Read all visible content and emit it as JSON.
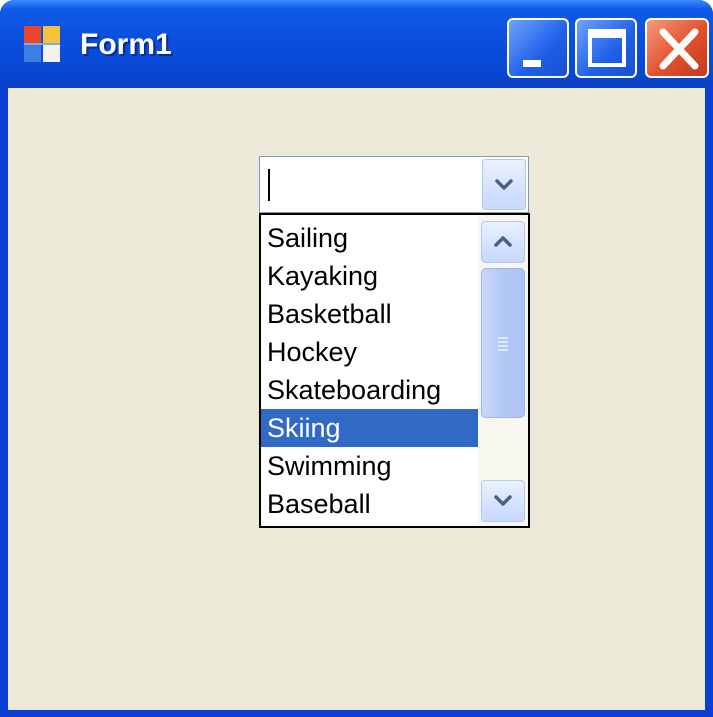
{
  "window": {
    "title": "Form1",
    "icons": {
      "app": "windows-form-icon",
      "minimize": "minimize-icon",
      "maximize": "maximize-icon",
      "close": "close-icon"
    }
  },
  "combobox": {
    "value": "",
    "dropdown_icon": "chevron-down-icon",
    "items": [
      "Sailing",
      "Kayaking",
      "Basketball",
      "Hockey",
      "Skateboarding",
      "Skiing",
      "Swimming",
      "Baseball"
    ],
    "selected_item": "Skiing",
    "scrollbar": {
      "up_icon": "chevron-up-icon",
      "down_icon": "chevron-down-icon",
      "grip_icon": "grip-lines-icon"
    }
  },
  "colors": {
    "titlebar": "#0b4fdc",
    "client_bg": "#ece9d8",
    "selection": "#316ac5",
    "close_button": "#e2502e"
  }
}
